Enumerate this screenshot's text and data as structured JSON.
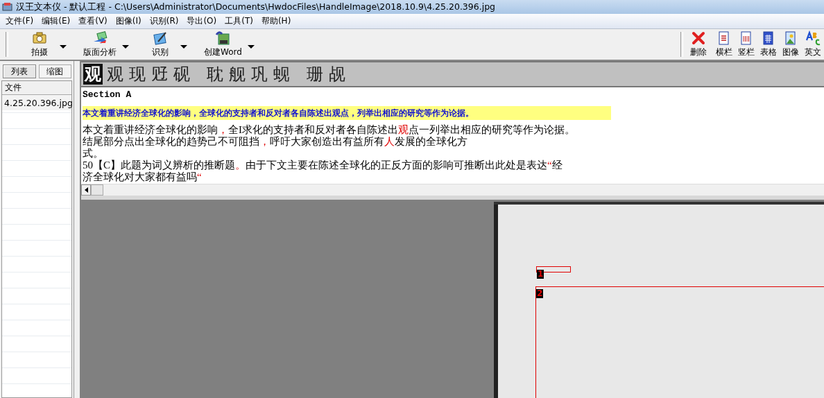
{
  "window": {
    "title": "汉王文本仪 - 默认工程 - C:\\Users\\Administrator\\Documents\\HwdocFiles\\HandleImage\\2018.10.9\\4.25.20.396.jpg"
  },
  "menu": [
    "文件(F)",
    "编辑(E)",
    "查看(V)",
    "图像(I)",
    "识别(R)",
    "导出(O)",
    "工具(T)",
    "帮助(H)"
  ],
  "toolbar_left": [
    {
      "label": "拍摄",
      "kind": "camera"
    },
    {
      "label": "版面分析",
      "kind": "layout"
    },
    {
      "label": "识别",
      "kind": "recognize"
    },
    {
      "label": "创建Word",
      "kind": "word"
    }
  ],
  "toolbar_right": [
    {
      "label": "删除",
      "kind": "delete"
    },
    {
      "label": "横栏",
      "kind": "rows"
    },
    {
      "label": "竖栏",
      "kind": "columns"
    },
    {
      "label": "表格",
      "kind": "table"
    },
    {
      "label": "图像",
      "kind": "image"
    },
    {
      "label": "英文",
      "kind": "english"
    }
  ],
  "side_tabs": [
    {
      "label": "列表",
      "selected": true
    },
    {
      "label": "缩图",
      "selected": false
    }
  ],
  "file_list": {
    "header": "文件",
    "items": [
      {
        "name": "4.25.20.396.jpg",
        "selected": true
      }
    ]
  },
  "candidates": [
    {
      "char": "观",
      "selected": true
    },
    {
      "char": "观",
      "selected": false
    },
    {
      "char": "现",
      "selected": false
    },
    {
      "char": "觃",
      "selected": false
    },
    {
      "char": "砚",
      "selected": false
    },
    {
      "char": "耽",
      "selected": false
    },
    {
      "char": "舰",
      "selected": false
    },
    {
      "char": "巩",
      "selected": false
    },
    {
      "char": "蚬",
      "selected": false
    },
    {
      "char": "珊",
      "selected": false
    },
    {
      "char": "觇",
      "selected": false
    }
  ],
  "text_lines": [
    {
      "kind": "heading",
      "segments": [
        {
          "text": "Section A",
          "flagged": false
        }
      ]
    },
    {
      "kind": "highlight",
      "segments": [
        {
          "text": "本文着重讲经济全球化的影响，全球化的支持者和反对者各自陈述出观点，列举出相应的研究等作为论据。",
          "flagged": false
        }
      ]
    },
    {
      "kind": "normal",
      "segments": [
        {
          "text": "本文着重讲经济全球化的影响",
          "flagged": false
        },
        {
          "text": "，",
          "flagged": true
        },
        {
          "text": "全I求化的支持者和反对者各自陈述出",
          "flagged": false
        },
        {
          "text": "观",
          "flagged": true
        },
        {
          "text": "点一列举出相应的研究等作为论据。",
          "flagged": false
        }
      ]
    },
    {
      "kind": "normal",
      "segments": [
        {
          "text": "结尾部分点出全球化的趋势己不可阻挡",
          "flagged": false
        },
        {
          "text": "，",
          "flagged": true
        },
        {
          "text": "呼吁大家创造出有益所有",
          "flagged": false
        },
        {
          "text": "人",
          "flagged": true
        },
        {
          "text": "发展的全球化方",
          "flagged": false
        }
      ]
    },
    {
      "kind": "normal",
      "segments": [
        {
          "text": "式。",
          "flagged": false
        }
      ]
    },
    {
      "kind": "normal",
      "segments": [
        {
          "text": "50【C】此题为词义辨析的推断题",
          "flagged": false
        },
        {
          "text": "。",
          "flagged": true
        },
        {
          "text": "由于下文主要在陈述全球化的正反方面的影响可推断出此处是表达",
          "flagged": false
        },
        {
          "text": "“",
          "flagged": true
        },
        {
          "text": "经",
          "flagged": false
        }
      ]
    },
    {
      "kind": "normal",
      "segments": [
        {
          "text": "济全球化对大家都有益吗",
          "flagged": false
        },
        {
          "text": "“",
          "flagged": true
        }
      ]
    }
  ],
  "regions": [
    {
      "label": "1"
    },
    {
      "label": "2"
    }
  ]
}
